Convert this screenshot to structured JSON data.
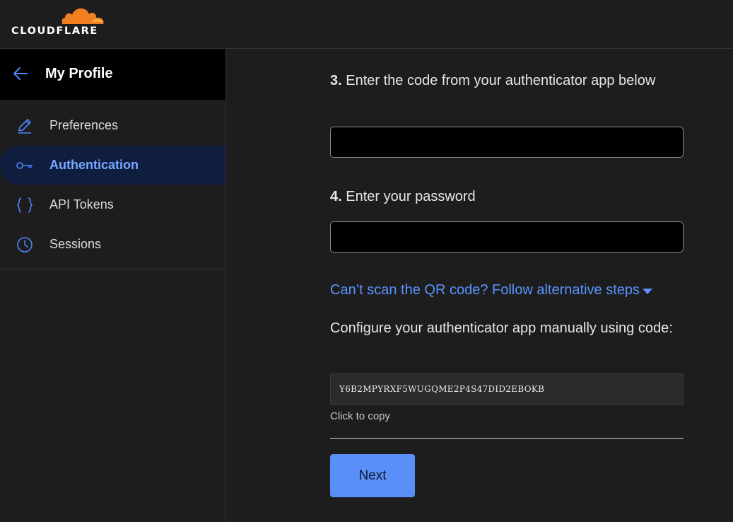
{
  "brand": {
    "name": "CLOUDFLARE",
    "cloud_color": "#f38020"
  },
  "sidebar": {
    "title": "My Profile",
    "items": [
      {
        "label": "Preferences",
        "icon": "pencil-icon",
        "active": false
      },
      {
        "label": "Authentication",
        "icon": "key-icon",
        "active": true
      },
      {
        "label": "API Tokens",
        "icon": "braces-icon",
        "active": false
      },
      {
        "label": "Sessions",
        "icon": "clock-icon",
        "active": false
      }
    ]
  },
  "main": {
    "step3": {
      "number": "3.",
      "text": "Enter the code from your authenticator app below",
      "value": "",
      "placeholder": ""
    },
    "step4": {
      "number": "4.",
      "text": "Enter your password",
      "value": "",
      "placeholder": ""
    },
    "alt_link": "Can’t scan the QR code? Follow alternative steps",
    "manual_text": "Configure your authenticator app manually using code:",
    "code": "Y6B2MPYRXF5WUGQME2P4S47DID2EBOKB",
    "copy_hint": "Click to copy",
    "next_label": "Next"
  },
  "colors": {
    "accent": "#5a8ff7",
    "link": "#5a93ff",
    "active_bg": "#0f1d3f"
  }
}
